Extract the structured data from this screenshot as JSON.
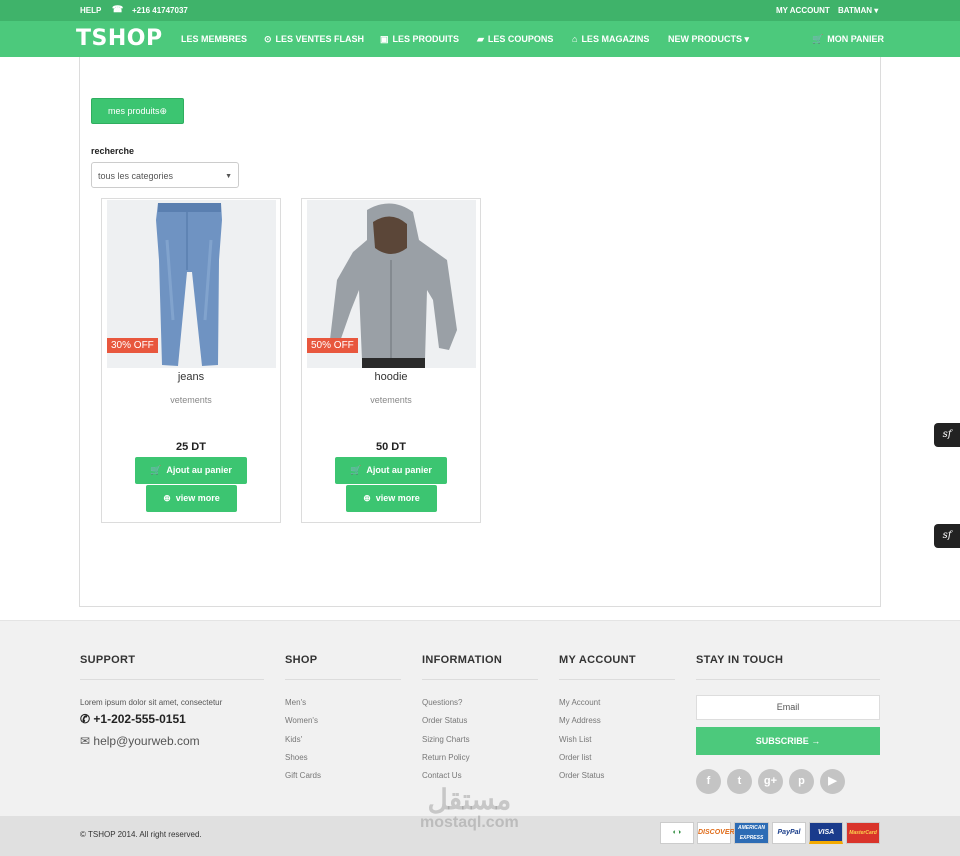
{
  "topbar": {
    "help": "HELP",
    "phone": "+216 41747037",
    "my_account": "MY ACCOUNT",
    "user": "BATMAN ▾"
  },
  "nav": {
    "logo": "TSHOP",
    "items": [
      {
        "label": "LES MEMBRES",
        "icon": ""
      },
      {
        "label": "LES VENTES FLASH",
        "icon": "clock-icon"
      },
      {
        "label": "LES PRODUITS",
        "icon": "box-icon"
      },
      {
        "label": "LES COUPONS",
        "icon": "ticket-icon"
      },
      {
        "label": "LES MAGAZINS",
        "icon": "home-icon"
      },
      {
        "label": "NEW PRODUCTS ▾",
        "icon": ""
      }
    ],
    "cart": "MON PANIER"
  },
  "main": {
    "mes_produits": "mes produits⊕",
    "search_label": "recherche",
    "category_select": "tous les categories",
    "products": [
      {
        "name": "jeans",
        "category": "vetements",
        "price": "25 DT",
        "discount": "30% OFF",
        "cart_label": "Ajout au panier",
        "view_label": "view more"
      },
      {
        "name": "hoodie",
        "category": "vetements",
        "price": "50 DT",
        "discount": "50% OFF",
        "cart_label": "Ajout au panier",
        "view_label": "view more"
      }
    ]
  },
  "footer": {
    "support": {
      "title": "SUPPORT",
      "text": "Lorem ipsum dolor sit amet, consectetur",
      "phone": "+1-202-555-0151",
      "email": "help@yourweb.com"
    },
    "shop": {
      "title": "SHOP",
      "links": [
        "Men's",
        "Women's",
        "Kids'",
        "Shoes",
        "Gift Cards"
      ]
    },
    "information": {
      "title": "INFORMATION",
      "links": [
        "Questions?",
        "Order Status",
        "Sizing Charts",
        "Return Policy",
        "Contact Us"
      ]
    },
    "my_account": {
      "title": "MY ACCOUNT",
      "links": [
        "My Account",
        "My Address",
        "Wish List",
        "Order list",
        "Order Status"
      ]
    },
    "stay_in_touch": {
      "title": "STAY IN TOUCH",
      "email_placeholder": "Email",
      "subscribe": "SUBSCRIBE →"
    },
    "copyright": "© TSHOP 2014. All right reserved.",
    "payments": [
      "",
      "DISCOVER",
      "AMERICAN EXPRESS",
      "PayPal",
      "VISA",
      "MasterCard"
    ]
  },
  "watermark": {
    "line1": "مستقل",
    "line2": "mostaql.com"
  }
}
